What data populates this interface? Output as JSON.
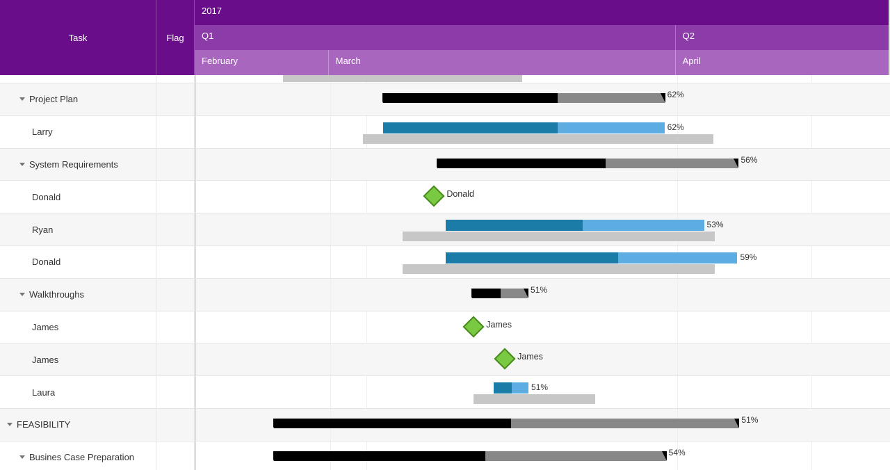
{
  "timeline": {
    "year": "2017",
    "quarters": [
      {
        "label": "Q1",
        "width_pct": 69.3
      },
      {
        "label": "Q2",
        "width_pct": 30.7
      }
    ],
    "months": [
      {
        "label": "February",
        "width_pct": 19.3
      },
      {
        "label": "March",
        "width_pct": 50.0
      },
      {
        "label": "April",
        "width_pct": 30.7
      }
    ]
  },
  "columns": {
    "task": "Task",
    "flag": "Flag"
  },
  "rows": [
    {
      "label": "",
      "indent": 1,
      "type": "cut",
      "bars": [
        {
          "kind": "base",
          "left_pct": 12.5,
          "width_pct": 34.5
        }
      ]
    },
    {
      "label": "Project Plan",
      "indent": 1,
      "expand": true,
      "alt": true,
      "bars": [
        {
          "kind": "summary",
          "left_pct": 27.0,
          "width_pct": 40.5,
          "progress": 62,
          "pct_label": "62%"
        }
      ]
    },
    {
      "label": "Larry",
      "indent": 2,
      "bars": [
        {
          "kind": "base",
          "left_pct": 24.0,
          "width_pct": 50.5
        },
        {
          "kind": "task",
          "left_pct": 27.0,
          "width_pct": 40.5,
          "progress": 62,
          "pct_label": "62%"
        }
      ]
    },
    {
      "label": "System Requirements",
      "indent": 1,
      "expand": true,
      "alt": true,
      "bars": [
        {
          "kind": "summary",
          "left_pct": 34.8,
          "width_pct": 43.3,
          "progress": 56,
          "pct_label": "56%"
        }
      ]
    },
    {
      "label": "Donald",
      "indent": 2,
      "bars": [
        {
          "kind": "milestone",
          "left_pct": 34.3,
          "ms_label": "Donald"
        }
      ]
    },
    {
      "label": "Ryan",
      "indent": 2,
      "alt": true,
      "bars": [
        {
          "kind": "base",
          "left_pct": 29.8,
          "width_pct": 45.0
        },
        {
          "kind": "task",
          "left_pct": 36.0,
          "width_pct": 37.2,
          "progress": 53,
          "pct_label": "53%"
        }
      ]
    },
    {
      "label": "Donald",
      "indent": 2,
      "bars": [
        {
          "kind": "base",
          "left_pct": 29.8,
          "width_pct": 45.0
        },
        {
          "kind": "task",
          "left_pct": 36.0,
          "width_pct": 42.0,
          "progress": 59,
          "pct_label": "59%"
        }
      ]
    },
    {
      "label": "Walkthroughs",
      "indent": 1,
      "expand": true,
      "alt": true,
      "bars": [
        {
          "kind": "short",
          "left_pct": 39.8,
          "width_pct": 8.0,
          "progress": 51,
          "pct_label": "51%"
        }
      ]
    },
    {
      "label": "James",
      "indent": 2,
      "bars": [
        {
          "kind": "milestone",
          "left_pct": 40.0,
          "ms_label": "James"
        }
      ]
    },
    {
      "label": "James",
      "indent": 2,
      "alt": true,
      "bars": [
        {
          "kind": "milestone",
          "left_pct": 44.5,
          "ms_label": "James"
        }
      ]
    },
    {
      "label": "Laura",
      "indent": 2,
      "bars": [
        {
          "kind": "base",
          "left_pct": 40.0,
          "width_pct": 17.5
        },
        {
          "kind": "task",
          "left_pct": 42.9,
          "width_pct": 5.0,
          "progress": 51,
          "pct_label": "51%"
        }
      ]
    },
    {
      "label": "FEASIBILITY",
      "indent": 0,
      "expand": true,
      "alt": true,
      "bars": [
        {
          "kind": "summary",
          "left_pct": 11.2,
          "width_pct": 67.0,
          "progress": 51,
          "pct_label": "51%"
        }
      ]
    },
    {
      "label": "Busines Case Preparation",
      "indent": 1,
      "expand": true,
      "bars": [
        {
          "kind": "summary",
          "left_pct": 11.2,
          "width_pct": 56.5,
          "progress": 54,
          "pct_label": "54%"
        }
      ]
    }
  ],
  "chart_data": {
    "type": "bar",
    "title": "",
    "xlabel": "2017 timeline",
    "ylabel": "Task",
    "timeline_months": [
      "February",
      "March",
      "April"
    ],
    "series": [
      {
        "name": "Project Plan",
        "type": "summary",
        "progress_pct": 62
      },
      {
        "name": "Larry",
        "type": "task",
        "progress_pct": 62,
        "has_baseline": true
      },
      {
        "name": "System Requirements",
        "type": "summary",
        "progress_pct": 56
      },
      {
        "name": "Donald",
        "type": "milestone"
      },
      {
        "name": "Ryan",
        "type": "task",
        "progress_pct": 53,
        "has_baseline": true
      },
      {
        "name": "Donald",
        "type": "task",
        "progress_pct": 59,
        "has_baseline": true
      },
      {
        "name": "Walkthroughs",
        "type": "summary",
        "progress_pct": 51
      },
      {
        "name": "James",
        "type": "milestone"
      },
      {
        "name": "James",
        "type": "milestone"
      },
      {
        "name": "Laura",
        "type": "task",
        "progress_pct": 51,
        "has_baseline": true
      },
      {
        "name": "FEASIBILITY",
        "type": "summary",
        "progress_pct": 51
      },
      {
        "name": "Busines Case Preparation",
        "type": "summary",
        "progress_pct": 54
      }
    ]
  }
}
